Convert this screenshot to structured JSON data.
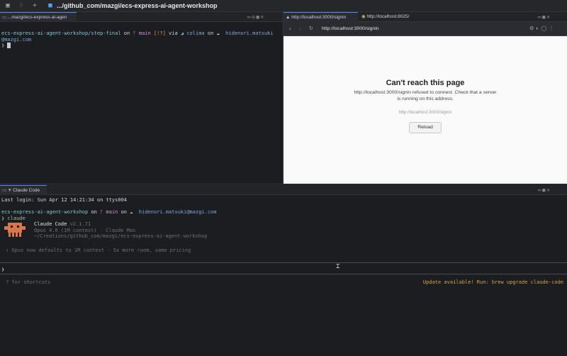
{
  "titlebar": {
    "title": ".../github_com/mazgi/ecs-express-ai-agent-workshop"
  },
  "left_pane": {
    "tab_label": "...mazgi/ecs-express-ai-agen",
    "prompt_path": "ecs-express-ai-agent-workshop/step-final",
    "prompt_on": "on",
    "prompt_branch": "main",
    "prompt_status": "[!?]",
    "prompt_via": "via",
    "prompt_colima": "colima",
    "prompt_on2": "on",
    "prompt_user": "hidenori.matsuki",
    "prompt_user_cont": "@mazgi.com",
    "prompt_symbol": "❯"
  },
  "browser": {
    "tab1_label": "http://localhost:3000/signin",
    "tab2_label": "http://localhost:8025/",
    "url": "http://localhost:3000/signin",
    "error_title": "Can't reach this page",
    "error_line1": "http://localhost:3000/signin refused to connect. Check that a server",
    "error_line2": "is running on this address.",
    "error_detail": "http://localhost:3000/signin",
    "reload_label": "Reload"
  },
  "bottom_pane": {
    "tab_label": "✳ Claude Code",
    "last_login": "Last login: Sun Apr 12 14:21:34 on ttys004",
    "prompt_path": "ecs-express-ai-agent-workshop",
    "prompt_on": "on",
    "prompt_branch": "main",
    "prompt_on2": "on",
    "prompt_user": "hidenori.matsuki@mazgi.com",
    "command": "❯ claude",
    "app_name": "Claude Code",
    "app_version": "v2.1.71",
    "model_line": "Opus 4.6 (1M context) · Claude Max",
    "cwd_line": "~/Creations/github_com/mazgi/ecs-express-ai-agent-workshop",
    "tip_line": "↑ Opus now defaults to 1M context · 5x more room, same pricing",
    "input_prompt": "❯",
    "shortcuts_hint": "? for shortcuts",
    "update_notice": "Update available! Run: brew upgrade claude-code"
  },
  "colors": {
    "accent": "#4a8cff",
    "claude_orange": "#d9774a",
    "update_yellow": "#d9a441"
  }
}
